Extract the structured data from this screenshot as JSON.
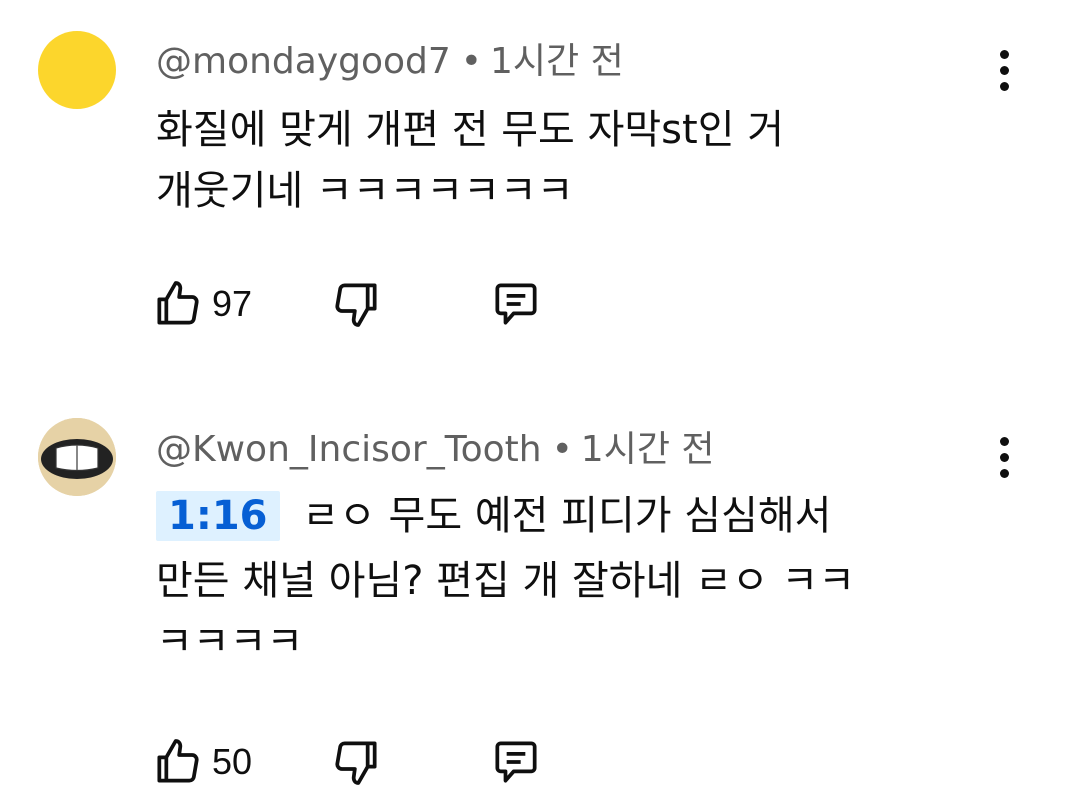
{
  "comments": [
    {
      "author": "@mondaygood7",
      "separator": "•",
      "time": "1시간 전",
      "timestamp_link": "",
      "text_lines": [
        "화질에 맞게 개편 전 무도 자막st인 거",
        "개웃기네 ㅋㅋㅋㅋㅋㅋㅋ"
      ],
      "like_count": "97",
      "avatar_color": "#fcd62c"
    },
    {
      "author": "@Kwon_Incisor_Tooth",
      "separator": "•",
      "time": "1시간 전",
      "timestamp_link": "1:16",
      "text_first": "ㄹㅇ 무도 예전 피디가 심심해서",
      "text_lines": [
        "만든 채널 아님? 편집 개 잘하네 ㄹㅇ ㅋㅋ",
        "ㅋㅋㅋㅋ"
      ],
      "like_count": "50",
      "avatar_color": "#e7d3a6"
    }
  ],
  "icons": {
    "like": "thumbs-up-icon",
    "dislike": "thumbs-down-icon",
    "reply": "reply-comment-icon",
    "more": "more-vertical-icon"
  },
  "colors": {
    "timestamp_link": "#065fd4",
    "timestamp_bg": "#def1ff",
    "meta_text": "#606060"
  }
}
